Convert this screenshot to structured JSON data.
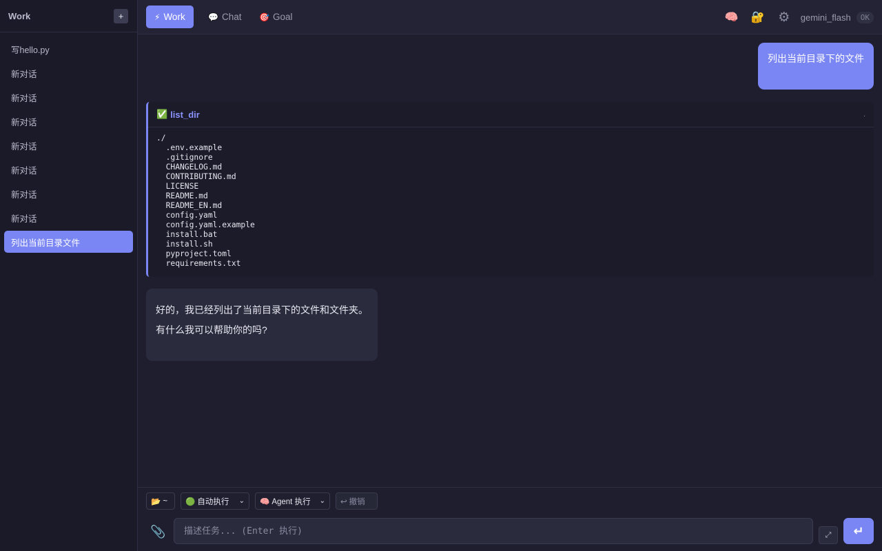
{
  "sidebar": {
    "title": "Work",
    "new_label": "+",
    "items": [
      {
        "label": "写hello.py"
      },
      {
        "label": "新对话"
      },
      {
        "label": "新对话"
      },
      {
        "label": "新对话"
      },
      {
        "label": "新对话"
      },
      {
        "label": "新对话"
      },
      {
        "label": "新对话"
      },
      {
        "label": "新对话"
      },
      {
        "label": "列出当前目录文件",
        "active": true
      }
    ]
  },
  "tabs": [
    {
      "icon": "⚡",
      "icon_name": "lightning-icon",
      "label": "Work",
      "active": true
    },
    {
      "icon": "💬",
      "icon_name": "speech-bubble-icon",
      "label": "Chat"
    },
    {
      "icon": "🎯",
      "icon_name": "target-icon",
      "label": "Goal"
    }
  ],
  "topbar": {
    "icons": [
      {
        "glyph": "🧠",
        "name": "brain-icon"
      },
      {
        "glyph": "🔐",
        "name": "lock-key-icon"
      },
      {
        "glyph": "⚙",
        "name": "gear-icon"
      }
    ],
    "model": "gemini_flash",
    "status": "OK"
  },
  "messages": {
    "user": "列出当前目录下的文件",
    "tool": {
      "status_icon": "✅",
      "name": "list_dir",
      "marker": ".",
      "output": "./\n  .env.example\n  .gitignore\n  CHANGELOG.md\n  CONTRIBUTING.md\n  LICENSE\n  README.md\n  README_EN.md\n  config.yaml\n  config.yaml.example\n  install.bat\n  install.sh\n  pyproject.toml\n  requirements.txt"
    },
    "assistant_lines": [
      "好的，我已经列出了当前目录下的文件和文件夹。",
      "有什么我可以帮助你的吗?"
    ]
  },
  "toolbar": {
    "dir": {
      "icon": "📂",
      "label": "~"
    },
    "exec_mode": {
      "icon": "🟢",
      "label": "自动执行"
    },
    "agent_mode": {
      "icon": "🧠",
      "label": "Agent 执行"
    },
    "undo": {
      "icon": "↩",
      "label": "撤销"
    }
  },
  "input": {
    "placeholder": "描述任务... (Enter 执行)",
    "attach_icon": "📎",
    "expand_icon": "⤢",
    "send_icon": "↵"
  },
  "colors": {
    "accent": "#7b86f5",
    "background": "#1e1e2e",
    "sidebar": "#1a1a28"
  }
}
